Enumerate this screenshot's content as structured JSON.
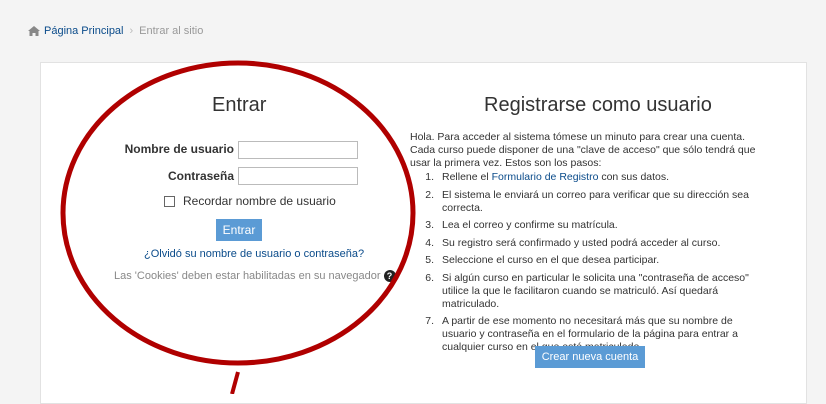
{
  "breadcrumb": {
    "home": "Página Principal",
    "separator": "›",
    "current": "Entrar al sitio"
  },
  "login": {
    "title": "Entrar",
    "username_label": "Nombre de usuario",
    "password_label": "Contraseña",
    "remember_label": "Recordar nombre de usuario",
    "submit": "Entrar",
    "forgot": "¿Olvidó su nombre de usuario o contraseña?",
    "cookies": "Las 'Cookies' deben estar habilitadas en su navegador",
    "help_glyph": "?"
  },
  "register": {
    "title": "Registrarse como usuario",
    "intro": "Hola. Para acceder al sistema tómese un minuto para crear una cuenta. Cada curso puede disponer de una \"clave de acceso\" que sólo tendrá que usar la primera vez. Estos son los pasos:",
    "step1_pre": "Rellene el ",
    "step1_link": "Formulario de Registro",
    "step1_post": " con sus datos.",
    "steps": [
      "El sistema le enviará un correo para verificar que su dirección sea correcta.",
      "Lea el correo y confirme su matrícula.",
      "Su registro será confirmado y usted podrá acceder al curso.",
      "Seleccione el curso en el que desea participar.",
      "Si algún curso en particular le solicita una \"contraseña de acceso\" utilice la que le facilitaron cuando se matriculó. Así quedará matriculado.",
      "A partir de ese momento no necesitará más que su nombre de usuario y contraseña en el formulario de la página para entrar a cualquier curso en el que esté matriculado."
    ],
    "numbers": [
      "1.",
      "2.",
      "3.",
      "4.",
      "5.",
      "6.",
      "7."
    ],
    "create_button": "Crear nueva cuenta"
  },
  "colors": {
    "accent": "#5b9bd5",
    "link": "#0a4b8a",
    "annotation": "#b00000"
  }
}
